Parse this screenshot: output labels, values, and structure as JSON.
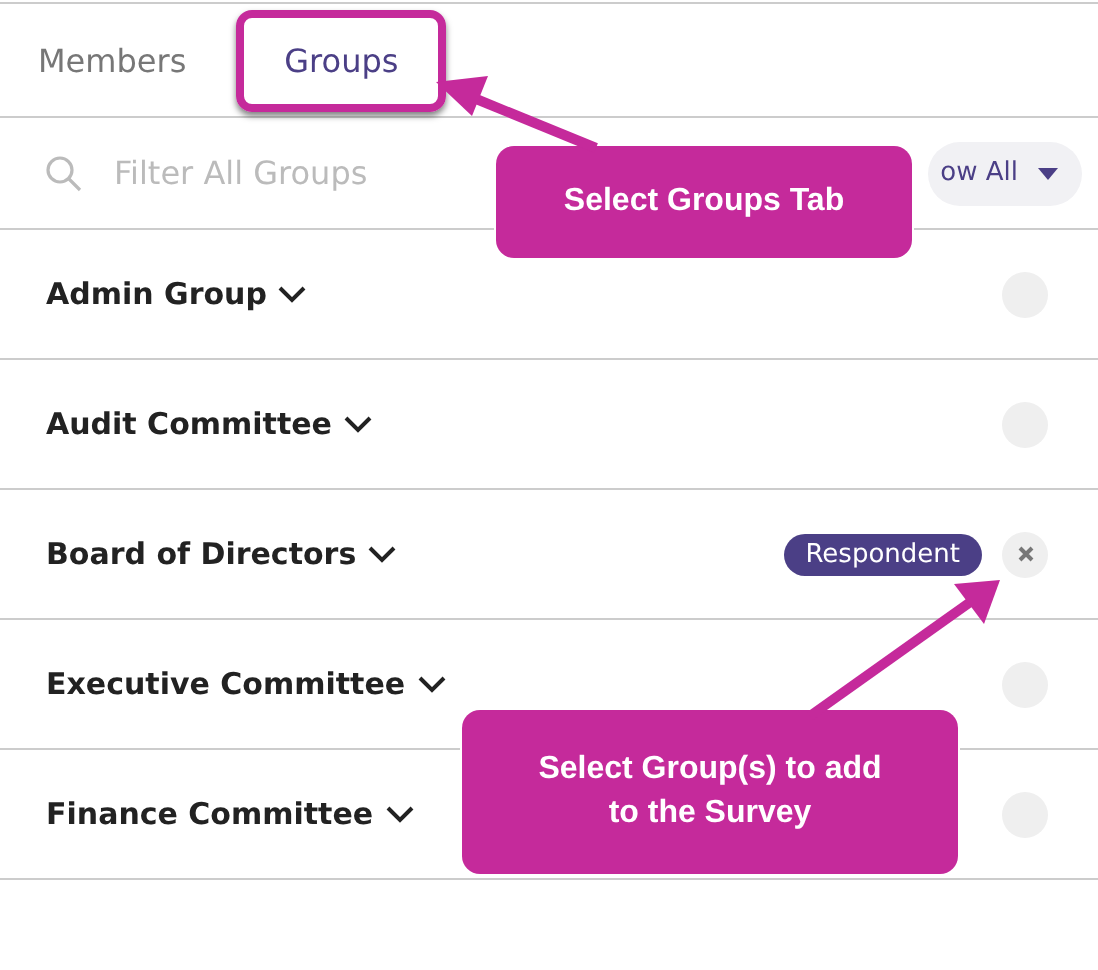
{
  "tabs": [
    {
      "label": "Members",
      "selected": false
    },
    {
      "label": "Groups",
      "selected": true
    }
  ],
  "search": {
    "placeholder": "Filter All Groups"
  },
  "filter_button": {
    "label": "ow All"
  },
  "groups": [
    {
      "name": "Admin Group",
      "selected": false
    },
    {
      "name": "Audit Committee",
      "selected": false
    },
    {
      "name": "Board of Directors",
      "selected": true,
      "badge": "Respondent"
    },
    {
      "name": "Executive Committee",
      "selected": false
    },
    {
      "name": "Finance Committee",
      "selected": false
    }
  ],
  "callouts": [
    {
      "text": "Select Groups Tab"
    },
    {
      "text": "Select Group(s) to add to the Survey"
    }
  ]
}
